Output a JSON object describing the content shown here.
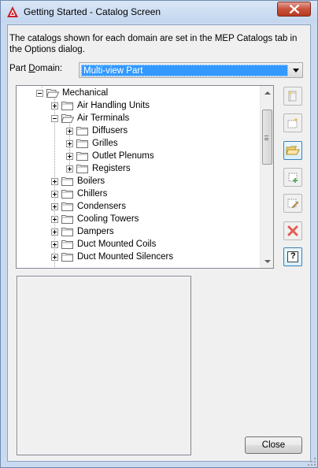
{
  "window": {
    "title": "Getting Started - Catalog Screen",
    "title_bar_color": "#c3d6ef",
    "close_button_color": "#c8523c"
  },
  "description": "The catalogs shown for each domain are set in the MEP Catalogs tab in the Options dialog.",
  "part_domain": {
    "label": "Part Domain:",
    "label_accel_letter": "D",
    "selected": "Multi-view Part"
  },
  "tree": {
    "items": [
      {
        "label": "Mechanical",
        "expanded": true,
        "level": 0
      },
      {
        "label": "Air Handling Units",
        "expanded": false,
        "level": 1
      },
      {
        "label": "Air Terminals",
        "expanded": true,
        "level": 1
      },
      {
        "label": "Diffusers",
        "expanded": false,
        "level": 2
      },
      {
        "label": "Grilles",
        "expanded": false,
        "level": 2
      },
      {
        "label": "Outlet Plenums",
        "expanded": false,
        "level": 2
      },
      {
        "label": "Registers",
        "expanded": false,
        "level": 2
      },
      {
        "label": "Boilers",
        "expanded": false,
        "level": 1
      },
      {
        "label": "Chillers",
        "expanded": false,
        "level": 1
      },
      {
        "label": "Condensers",
        "expanded": false,
        "level": 1
      },
      {
        "label": "Cooling Towers",
        "expanded": false,
        "level": 1
      },
      {
        "label": "Dampers",
        "expanded": false,
        "level": 1
      },
      {
        "label": "Duct Mounted Coils",
        "expanded": false,
        "level": 1
      },
      {
        "label": "Duct Mounted Silencers",
        "expanded": false,
        "level": 1
      }
    ]
  },
  "side_buttons": [
    {
      "name": "new-catalog-button",
      "icon": "new-document-icon"
    },
    {
      "name": "new-chapter-button",
      "icon": "sparkle-box-icon"
    },
    {
      "name": "open-catalog-button",
      "icon": "folder-open-icon"
    },
    {
      "name": "add-part-button",
      "icon": "add-part-icon"
    },
    {
      "name": "edit-part-button",
      "icon": "edit-part-icon"
    },
    {
      "name": "delete-button",
      "icon": "red-x-icon"
    },
    {
      "name": "help-button",
      "icon": "help-icon",
      "text": "?"
    }
  ],
  "close_label": "Close"
}
